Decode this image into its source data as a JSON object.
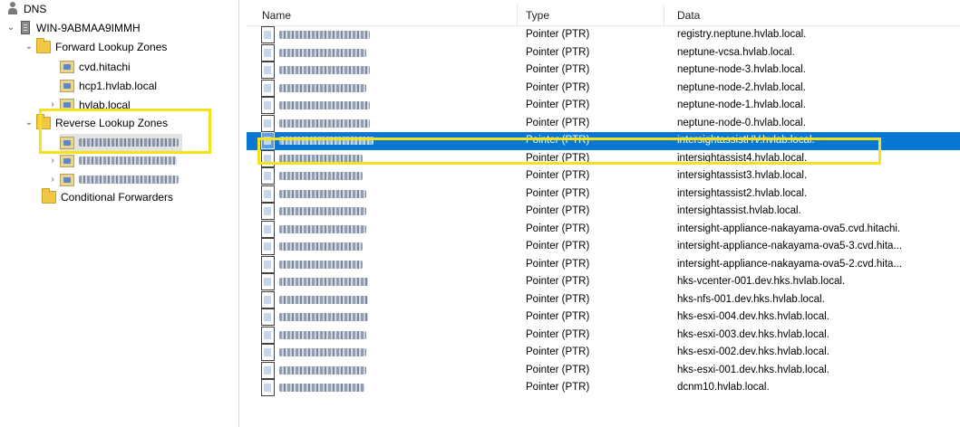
{
  "tree": {
    "root_label": "DNS",
    "server_label": "WIN-9ABMAA9IMMH",
    "forward_zones_label": "Forward Lookup Zones",
    "forward_zones": [
      "cvd.hitachi",
      "hcp1.hvlab.local",
      "hvlab.local"
    ],
    "reverse_zones_label": "Reverse Lookup Zones",
    "conditional_forwarders_label": "Conditional Forwarders"
  },
  "list": {
    "columns": [
      "Name",
      "Type",
      "Data"
    ],
    "rows": [
      {
        "type": "Pointer (PTR)",
        "data": "registry.neptune.hvlab.local."
      },
      {
        "type": "Pointer (PTR)",
        "data": "neptune-vcsa.hvlab.local."
      },
      {
        "type": "Pointer (PTR)",
        "data": "neptune-node-3.hvlab.local."
      },
      {
        "type": "Pointer (PTR)",
        "data": "neptune-node-2.hvlab.local."
      },
      {
        "type": "Pointer (PTR)",
        "data": "neptune-node-1.hvlab.local."
      },
      {
        "type": "Pointer (PTR)",
        "data": "neptune-node-0.hvlab.local."
      },
      {
        "type": "Pointer (PTR)",
        "data": "intersightassistHV.hvlab.local.",
        "selected": true
      },
      {
        "type": "Pointer (PTR)",
        "data": "intersightassist4.hvlab.local."
      },
      {
        "type": "Pointer (PTR)",
        "data": "intersightassist3.hvlab.local."
      },
      {
        "type": "Pointer (PTR)",
        "data": "intersightassist2.hvlab.local."
      },
      {
        "type": "Pointer (PTR)",
        "data": "intersightassist.hvlab.local."
      },
      {
        "type": "Pointer (PTR)",
        "data": "intersight-appliance-nakayama-ova5.cvd.hitachi."
      },
      {
        "type": "Pointer (PTR)",
        "data": "intersight-appliance-nakayama-ova5-3.cvd.hita..."
      },
      {
        "type": "Pointer (PTR)",
        "data": "intersight-appliance-nakayama-ova5-2.cvd.hita..."
      },
      {
        "type": "Pointer (PTR)",
        "data": "hks-vcenter-001.dev.hks.hvlab.local."
      },
      {
        "type": "Pointer (PTR)",
        "data": "hks-nfs-001.dev.hks.hvlab.local."
      },
      {
        "type": "Pointer (PTR)",
        "data": "hks-esxi-004.dev.hks.hvlab.local."
      },
      {
        "type": "Pointer (PTR)",
        "data": "hks-esxi-003.dev.hks.hvlab.local."
      },
      {
        "type": "Pointer (PTR)",
        "data": "hks-esxi-002.dev.hks.hvlab.local."
      },
      {
        "type": "Pointer (PTR)",
        "data": "hks-esxi-001.dev.hks.hvlab.local."
      },
      {
        "type": "Pointer (PTR)",
        "data": "dcnm10.hvlab.local."
      }
    ]
  },
  "colors": {
    "selection": "#0a77d2",
    "highlight_box": "#f4e21a",
    "folder": "#f2c744"
  },
  "icons": {
    "root": "dns-icon",
    "server": "server-icon",
    "folder": "folder-icon",
    "zone": "zone-icon",
    "record": "ptr-record-icon"
  }
}
